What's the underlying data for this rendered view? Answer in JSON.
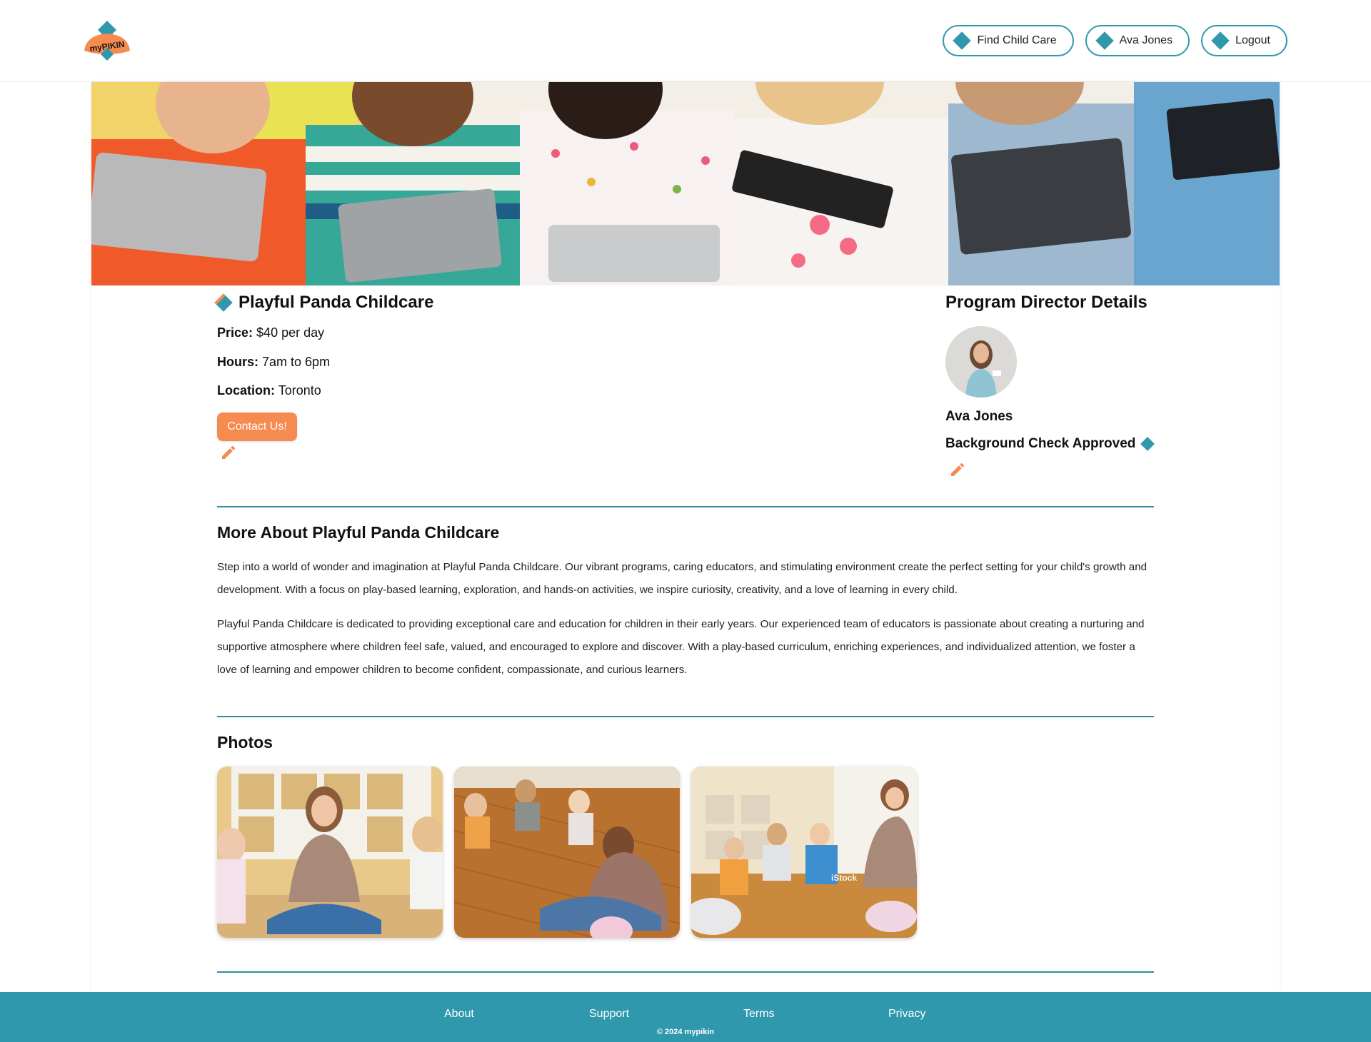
{
  "app": {
    "logo_text": "myPIKIN",
    "colors": {
      "primary": "#2f98ad",
      "accent": "#f58b4f",
      "text": "#111111"
    }
  },
  "header": {
    "nav": [
      {
        "label": "Find Child Care",
        "icon": "diamond-icon"
      },
      {
        "label": "Ava Jones",
        "icon": "diamond-icon"
      },
      {
        "label": "Logout",
        "icon": "diamond-icon"
      }
    ]
  },
  "provider": {
    "name": "Playful Panda Childcare",
    "price_label": "Price:",
    "price": "$40 per day",
    "hours_label": "Hours:",
    "hours": "7am to 6pm",
    "location_label": "Location:",
    "location": "Toronto",
    "contact_label": "Contact Us!",
    "edit_icon": "pencil-icon"
  },
  "director": {
    "title": "Program Director Details",
    "name": "Ava Jones",
    "background_check": "Background Check Approved",
    "edit_icon": "pencil-icon"
  },
  "about": {
    "title": "More About Playful Panda Childcare",
    "paragraphs": [
      "Step into a world of wonder and imagination at Playful Panda Childcare. Our vibrant programs, caring educators, and stimulating environment create the perfect setting for your child's growth and development. With a focus on play-based learning, exploration, and hands-on activities, we inspire curiosity, creativity, and a love of learning in every child.",
      "Playful Panda Childcare is dedicated to providing exceptional care and education for children in their early years. Our experienced team of educators is passionate about creating a nurturing and supportive atmosphere where children feel safe, valued, and encouraged to explore and discover. With a play-based curriculum, enriching experiences, and individualized attention, we foster a love of learning and empower children to become confident, compassionate, and curious learners."
    ]
  },
  "photos": {
    "title": "Photos",
    "watermark": "iStock"
  },
  "footer": {
    "links": [
      "About",
      "Support",
      "Terms",
      "Privacy"
    ],
    "copyright": "© 2024 mypikin"
  }
}
